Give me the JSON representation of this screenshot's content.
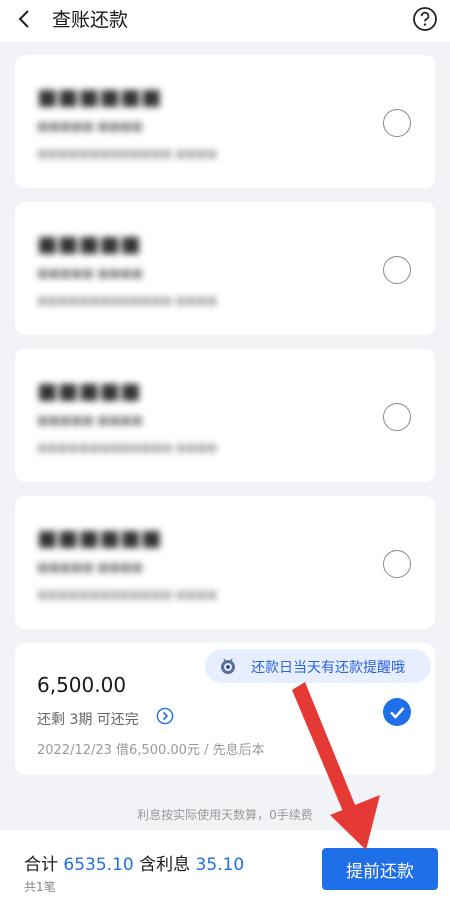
{
  "header": {
    "title": "查账还款"
  },
  "loans": [
    {
      "amount": "6,500.00",
      "status_text": "还剩 3期 可还完",
      "detail": "2022/12/23 借6,500.00元 / 先息后本",
      "checked": true
    }
  ],
  "tip": {
    "text": "还款日当天有还款提醒哦"
  },
  "note": "利息按实际使用天数算，0手续费",
  "bottom_bar": {
    "total_label": "合计",
    "total_value": "6535.10",
    "interest_label": "含利息",
    "interest_value": "35.10",
    "count_text": "共1笔",
    "button_label": "提前还款"
  },
  "colors": {
    "accent": "#1f6fe8",
    "tip_bg": "#e7efff",
    "arrow": "#e53935"
  }
}
